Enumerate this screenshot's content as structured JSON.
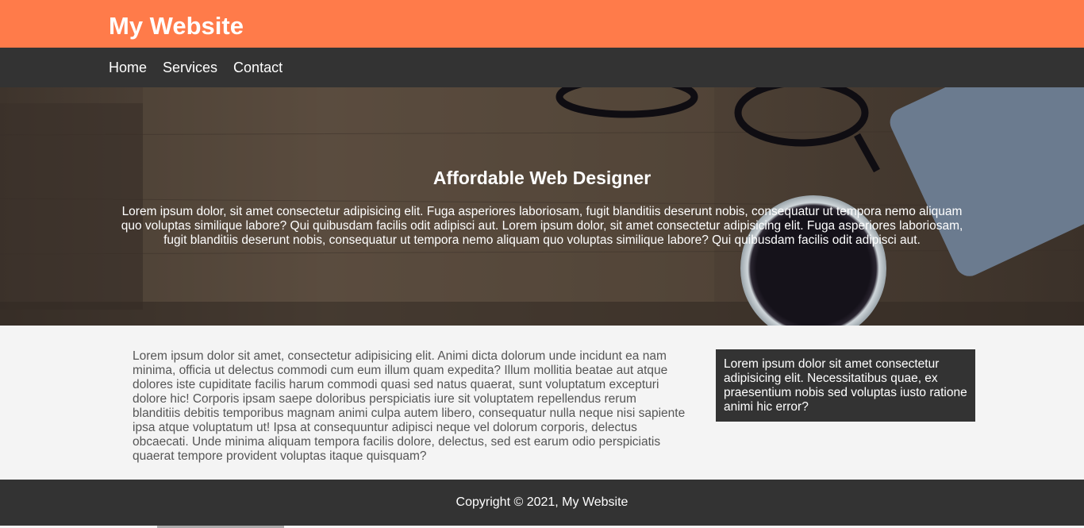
{
  "header": {
    "brand": "My Website"
  },
  "nav": {
    "items": [
      "Home",
      "Services",
      "Contact"
    ]
  },
  "hero": {
    "title": "Affordable Web Designer",
    "text": "Lorem ipsum dolor, sit amet consectetur adipisicing elit. Fuga asperiores laboriosam, fugit blanditiis deserunt nobis, consequatur ut tempora nemo aliquam quo voluptas similique labore? Qui quibusdam facilis odit adipisci aut. Lorem ipsum dolor, sit amet consectetur adipisicing elit. Fuga asperiores laboriosam, fugit blanditiis deserunt nobis, consequatur ut tempora nemo aliquam quo voluptas similique labore? Qui quibusdam facilis odit adipisci aut."
  },
  "main": {
    "text": "Lorem ipsum dolor sit amet, consectetur adipisicing elit. Animi dicta dolorum unde incidunt ea nam minima, officia ut delectus commodi cum eum illum quam expedita? Illum mollitia beatae aut atque dolores iste cupiditate facilis harum commodi quasi sed natus quaerat, sunt voluptatum excepturi dolore hic! Corporis ipsam saepe doloribus perspiciatis iure sit voluptatem repellendus rerum blanditiis debitis temporibus magnam animi culpa autem libero, consequatur nulla neque nisi sapiente ipsa atque voluptatum ut! Ipsa at consequuntur adipisci neque vel dolorum corporis, delectus obcaecati. Unde minima aliquam tempora facilis dolore, delectus, sed est earum odio perspiciatis quaerat tempore provident voluptas itaque quisquam?"
  },
  "sidebar": {
    "text": "Lorem ipsum dolor sit amet consectetur adipisicing elit. Necessitatibus quae, ex praesentium nobis sed voluptas iusto ratione animi hic error?"
  },
  "footer": {
    "copyright": "Copyright © 2021, My Website"
  },
  "colors": {
    "accent": "#ff7b4a",
    "dark": "#333333",
    "background": "#f4f4f4"
  }
}
